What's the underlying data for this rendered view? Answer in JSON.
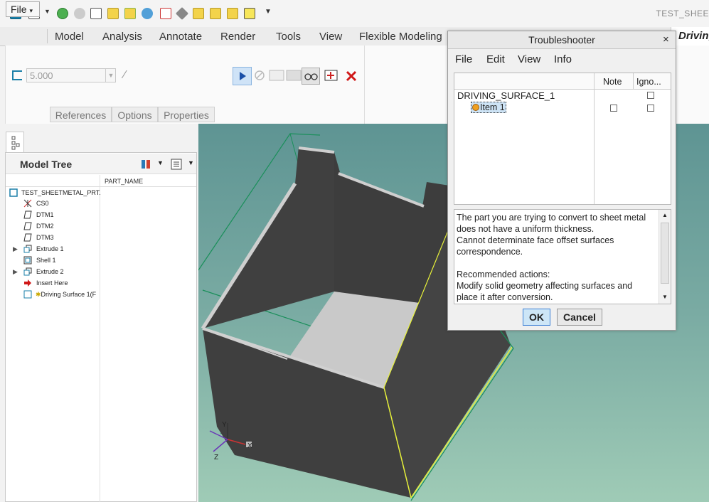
{
  "app": {
    "title": "TEST_SHEE"
  },
  "tabs": [
    {
      "label": "File"
    },
    {
      "label": "Model"
    },
    {
      "label": "Analysis"
    },
    {
      "label": "Annotate"
    },
    {
      "label": "Render"
    },
    {
      "label": "Tools"
    },
    {
      "label": "View"
    },
    {
      "label": "Flexible Modeling"
    }
  ],
  "active_tab_fragment": "Driving",
  "ribbon": {
    "thickness_value": "5.000",
    "subtabs": [
      {
        "label": "References"
      },
      {
        "label": "Options"
      },
      {
        "label": "Properties"
      }
    ]
  },
  "model_tree": {
    "title": "Model Tree",
    "column_header": "PART_NAME",
    "items": [
      {
        "label": "TEST_SHEETMETAL_PRT."
      },
      {
        "label": "CS0"
      },
      {
        "label": "DTM1"
      },
      {
        "label": "DTM2"
      },
      {
        "label": "DTM3"
      },
      {
        "label": "Extrude 1"
      },
      {
        "label": "Shell 1"
      },
      {
        "label": "Extrude 2"
      },
      {
        "label": "Insert Here"
      },
      {
        "label": "Driving Surface 1(F"
      }
    ]
  },
  "troubleshooter": {
    "title": "Troubleshooter",
    "close_glyph": "×",
    "menu": [
      {
        "label": "File"
      },
      {
        "label": "Edit"
      },
      {
        "label": "View"
      },
      {
        "label": "Info"
      }
    ],
    "columns": {
      "note": "Note",
      "ignore": "Igno..."
    },
    "rows": [
      {
        "label": "DRIVING_SURFACE_1"
      },
      {
        "label": "Item 1"
      }
    ],
    "message_lines": [
      "The part you are trying to convert to sheet metal",
      "does not have a uniform thickness.",
      "Cannot determinate face offset surfaces",
      "correspondence.",
      "",
      "Recommended actions:",
      "Modify solid geometry affecting surfaces and",
      "place it after conversion."
    ],
    "ok_label": "OK",
    "cancel_label": "Cancel"
  },
  "triad_labels": {
    "y": "Y",
    "z": "Z",
    "x": "X"
  },
  "colors": {
    "accent": "#3b7fd6",
    "edge_green": "#1a8f5a",
    "edge_yellow": "#e8f23a",
    "solid": "#3f3f3f",
    "face_light": "#c9c9c9"
  }
}
